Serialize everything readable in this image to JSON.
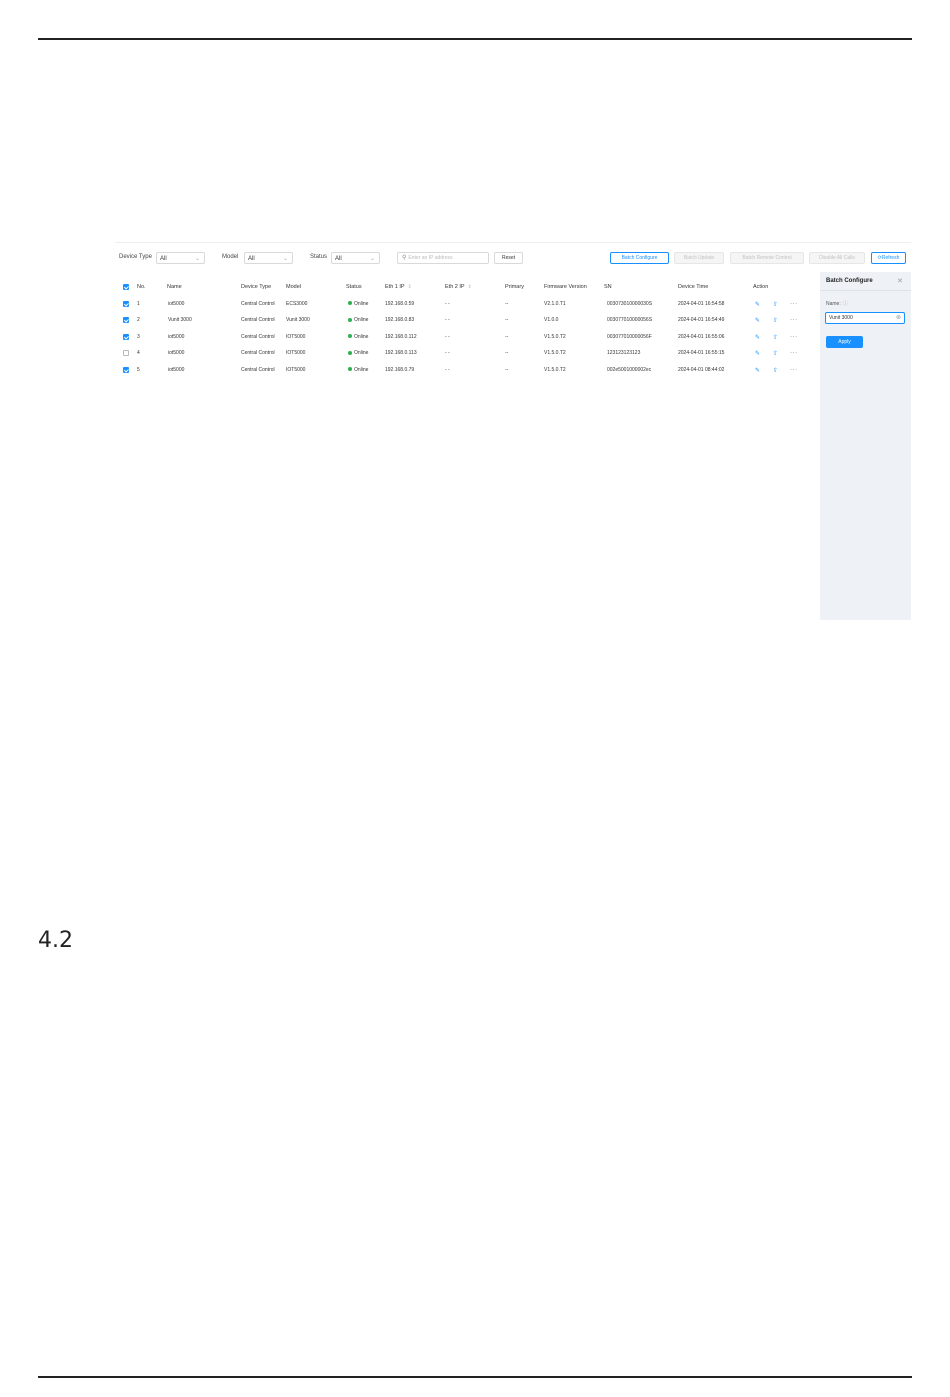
{
  "page": {
    "section_number": "4.2"
  },
  "filters": {
    "device_type_label": "Device Type",
    "device_type_value": "All",
    "model_label": "Model",
    "model_value": "All",
    "status_label": "Status",
    "status_value": "All",
    "search_placeholder": "Enter an IP address",
    "reset_label": "Reset"
  },
  "toolbar": {
    "batch_configure": "Batch Configure",
    "batch_update": "Batch Update",
    "batch_remote_control": "Batch Remote Control",
    "disable_all_calls": "Disable All Calls",
    "refresh": "Refresh"
  },
  "table": {
    "columns": {
      "no": "No.",
      "name": "Name",
      "device_type": "Device Type",
      "model": "Model",
      "status": "Status",
      "eth1": "Eth 1 IP",
      "eth2": "Eth 2 IP",
      "primary": "Primary",
      "firmware": "Firmware Version",
      "sn": "SN",
      "device_time": "Device Time",
      "action": "Action"
    },
    "header_checked": true,
    "rows": [
      {
        "checked": true,
        "no": "1",
        "name": "iot5000",
        "device_type": "Central Control",
        "model": "ECS3000",
        "status": "Online",
        "eth1": "192.168.0.59",
        "eth2": "- -",
        "primary": "--",
        "firmware": "V2.1.0.T1",
        "sn": "003073010000030S",
        "device_time": "2024-04-01 16:54:58"
      },
      {
        "checked": true,
        "no": "2",
        "name": "Vunit 3000",
        "device_type": "Central Control",
        "model": "Vunit 3000",
        "status": "Online",
        "eth1": "192.168.0.83",
        "eth2": "- -",
        "primary": "--",
        "firmware": "V1.0.0",
        "sn": "003077010000056S",
        "device_time": "2024-04-01 16:54:49"
      },
      {
        "checked": true,
        "no": "3",
        "name": "iot5000",
        "device_type": "Central Control",
        "model": "IOT5000",
        "status": "Online",
        "eth1": "192.168.0.112",
        "eth2": "- -",
        "primary": "--",
        "firmware": "V1.5.0.T2",
        "sn": "003077010000056F",
        "device_time": "2024-04-01 16:55:06"
      },
      {
        "checked": false,
        "no": "4",
        "name": "iot5000",
        "device_type": "Central Control",
        "model": "IOT5000",
        "status": "Online",
        "eth1": "192.168.0.113",
        "eth2": "- -",
        "primary": "--",
        "firmware": "V1.5.0.T2",
        "sn": "123123123123",
        "device_time": "2024-04-01 16:55:15"
      },
      {
        "checked": true,
        "no": "5",
        "name": "iot5000",
        "device_type": "Central Control",
        "model": "IOT5000",
        "status": "Online",
        "eth1": "192.168.0.79",
        "eth2": "- -",
        "primary": "--",
        "firmware": "V1.5.0.T2",
        "sn": "002e5001000002ec",
        "device_time": "2024-04-01 08:44:02"
      }
    ]
  },
  "panel": {
    "title": "Batch Configure",
    "name_label": "Name:",
    "name_value": "Vunit 3000",
    "apply_label": "Apply"
  },
  "icons": {
    "edit": "edit-icon",
    "upgrade": "upgrade-icon",
    "more": "more-icon"
  },
  "colors": {
    "accent": "#1890ff",
    "online": "#2bb24c"
  }
}
